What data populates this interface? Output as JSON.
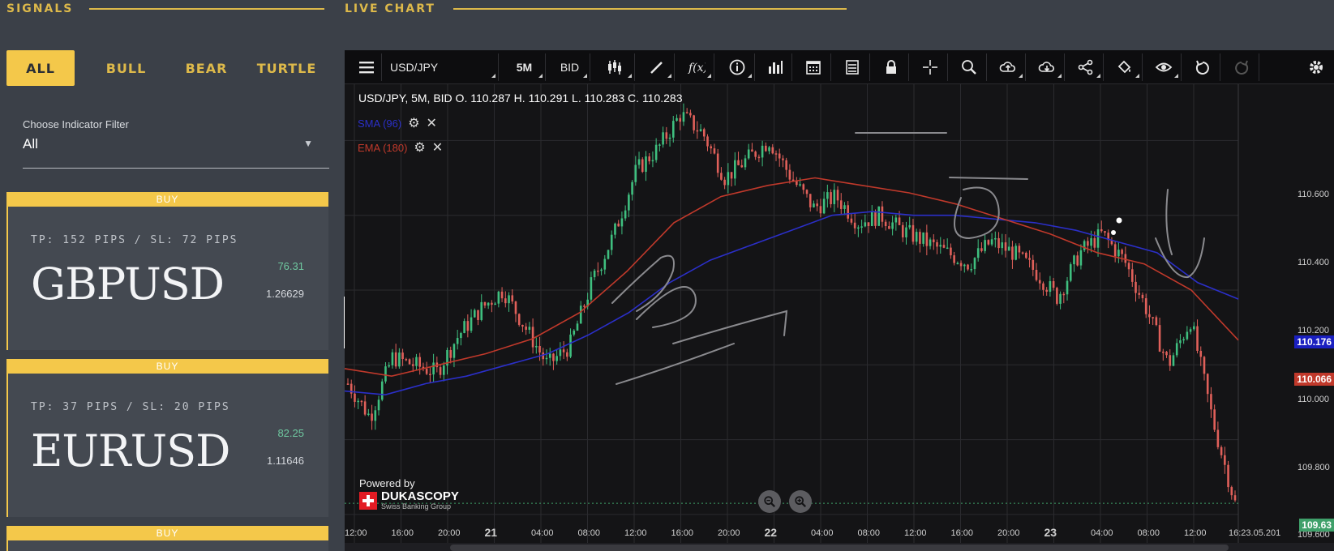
{
  "header": {
    "signals": "SIGNALS",
    "live_chart": "LIVE CHART"
  },
  "filter_tabs": [
    "ALL",
    "BULL",
    "BEAR",
    "TURTLE"
  ],
  "indicator": {
    "label": "Choose Indicator Filter",
    "value": "All"
  },
  "signals": [
    {
      "badge": "BUY",
      "tpsl": "TP: 152 PIPS / SL: 72 PIPS",
      "pair": "GBPUSD",
      "pct": "76.31",
      "price": "1.26629"
    },
    {
      "badge": "BUY",
      "tpsl": "TP: 37 PIPS / SL: 20 PIPS",
      "pair": "EURUSD",
      "pct": "82.25",
      "price": "1.11646"
    },
    {
      "badge": "BUY"
    }
  ],
  "toolbar": {
    "instrument": "USD/JPY",
    "period": "5M",
    "side": "BID"
  },
  "chart": {
    "legend": "USD/JPY, 5M, BID   O. 110.287 H. 110.291 L. 110.283 C. 110.283",
    "ma1": "SMA (96)",
    "ma2": "EMA (180)",
    "powered_by": "Powered by",
    "brand": "DUKASCOPY",
    "brand_sub": "Swiss Banking Group",
    "price_labels": [
      "110.600",
      "110.400",
      "110.200",
      "110.000",
      "109.800",
      "109.600"
    ],
    "sma_tag": "110.176",
    "ema_tag": "110.066",
    "last_tag": "109.63",
    "time_labels": [
      "12:00",
      "16:00",
      "20:00",
      "21",
      "04:00",
      "08:00",
      "12:00",
      "16:00",
      "20:00",
      "22",
      "04:00",
      "08:00",
      "12:00",
      "16:00",
      "20:00",
      "23",
      "04:00",
      "08:00",
      "12:00",
      "16:23.05.201"
    ],
    "colors": {
      "sma": "#2b2fc8",
      "ema": "#c0392b",
      "up": "#3fbf7f",
      "down": "#e0605a"
    }
  },
  "chart_data": {
    "type": "candlestick",
    "title": "USD/JPY, 5M, BID",
    "x_ticks": [
      "12:00",
      "16:00",
      "20:00",
      "21",
      "04:00",
      "08:00",
      "12:00",
      "16:00",
      "20:00",
      "22",
      "04:00",
      "08:00",
      "12:00",
      "16:00",
      "20:00",
      "23",
      "04:00",
      "08:00",
      "12:00"
    ],
    "ylim": [
      109.55,
      110.72
    ],
    "close_path": [
      109.95,
      109.86,
      110.02,
      110.0,
      109.98,
      110.08,
      110.15,
      110.2,
      110.1,
      110.0,
      110.05,
      110.22,
      110.35,
      110.52,
      110.58,
      110.67,
      110.62,
      110.5,
      110.55,
      110.6,
      110.5,
      110.42,
      110.45,
      110.38,
      110.4,
      110.36,
      110.33,
      110.3,
      110.27,
      110.33,
      110.3,
      110.25,
      110.18,
      110.3,
      110.35,
      110.28,
      110.15,
      110.0,
      110.12,
      109.85,
      109.63
    ],
    "sma_path": [
      109.93,
      109.92,
      109.95,
      109.97,
      110.0,
      110.03,
      110.08,
      110.14,
      110.22,
      110.28,
      110.32,
      110.36,
      110.4,
      110.41,
      110.4,
      110.4,
      110.39,
      110.38,
      110.36,
      110.33,
      110.3,
      110.22,
      110.176
    ],
    "ema_path": [
      109.99,
      109.97,
      110.0,
      110.03,
      110.07,
      110.14,
      110.25,
      110.38,
      110.45,
      110.48,
      110.5,
      110.48,
      110.46,
      110.43,
      110.39,
      110.35,
      110.3,
      110.27,
      110.2,
      110.066
    ]
  }
}
